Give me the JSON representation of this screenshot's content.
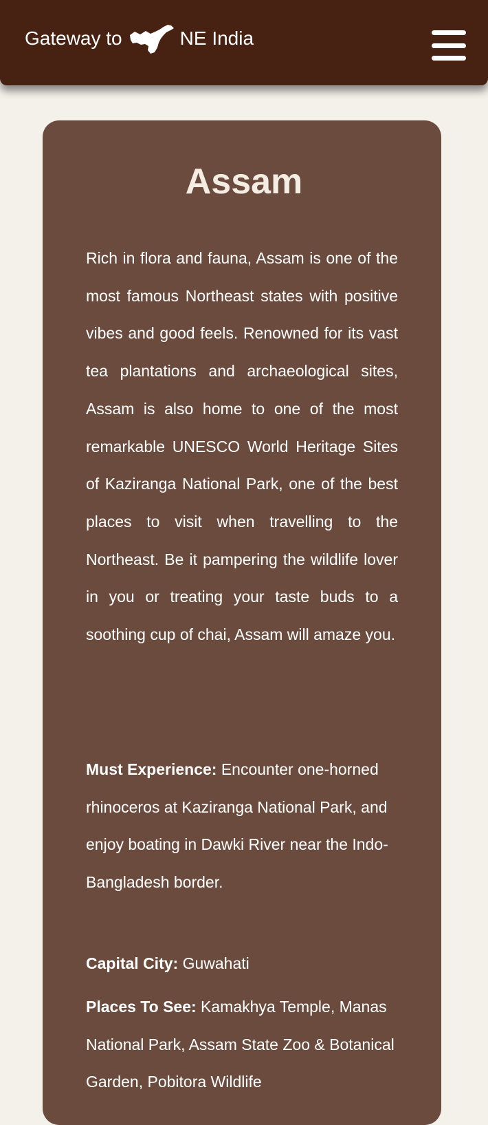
{
  "navbar": {
    "brand_prefix": "Gateway to",
    "brand_suffix": "NE India",
    "brand_icon": "assam-map-silhouette-icon",
    "menu_icon": "hamburger-menu-icon",
    "background_color": "#472213"
  },
  "state": {
    "name": "Assam",
    "description": "Rich in flora and fauna, Assam is one of the most famous Northeast states with positive vibes and good feels. Renowned for its vast tea plantations and archaeological sites, Assam is also home to one of the most remarkable UNESCO World Heritage Sites of Kaziranga National Park, one of the best places to visit when travelling to the Northeast. Be it pampering the wildlife lover in you or treating your taste buds to a soothing cup of chai, Assam will amaze you.",
    "facts": {
      "experience": {
        "label": "Must Experience:",
        "value": "Encounter one-horned rhinoceros at Kaziranga National Park, and enjoy boating in Dawki River near the Indo-Bangladesh border."
      },
      "capital": {
        "label": "Capital City:",
        "value": "Guwahati"
      },
      "places": {
        "label": "Places To See:",
        "value": "Kamakhya Temple, Manas National Park, Assam State Zoo & Botanical Garden, Pobitora Wildlife"
      }
    }
  },
  "colors": {
    "page_background": "#f4f0ea",
    "card_background": "#6b4b3d",
    "title_color": "#f4ede4"
  }
}
